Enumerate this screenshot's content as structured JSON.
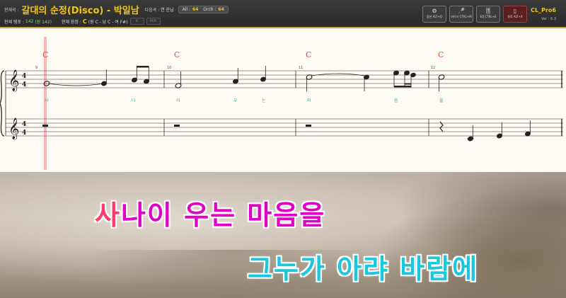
{
  "topbar": {
    "current_label": "현재곡 :",
    "song_title": "갈대의 순정(Disco)  -  박일남",
    "next_label": "다음곡 :",
    "next_value": "연 운님",
    "all_label": "All :",
    "all_value": "64",
    "orch_label": "Orch :",
    "orch_value": "64",
    "tempo_label": "현재 템포 :",
    "tempo_value": "142",
    "tempo_orig": "(원 142)",
    "key_label": "현재 음정 :",
    "key_value": "C",
    "key_detail": "(원 C - 남 C - 여 F#)",
    "small_btn1": "K",
    "small_btn2": "M/R",
    "buttons": [
      {
        "icon": "⚙",
        "label": "옵션 ALT+O"
      },
      {
        "icon": "🎤",
        "label": "마이크 CTRL+M"
      },
      {
        "icon": "🎚",
        "label": "EQ CTRL+E"
      },
      {
        "icon": "▯",
        "label": "종료 ALT+X"
      }
    ],
    "brand": "CL_Pro6",
    "version": "Ver : 6.3"
  },
  "score": {
    "chords": [
      "C",
      "C",
      "C",
      "C"
    ],
    "measure_numbers": [
      "9",
      "10",
      "11",
      "12"
    ],
    "time_signature": [
      "4",
      "4"
    ],
    "lyric_syllables": [
      "사",
      "나",
      "이",
      "우",
      "는",
      "마",
      "음",
      "을"
    ],
    "accent_red": "#e8503a",
    "playhead_color": "#ff6060"
  },
  "lyrics": {
    "line1_highlight": "사",
    "line1_rest": "나이 우는 마음을",
    "line2": "그누가 아랴 바람에"
  }
}
